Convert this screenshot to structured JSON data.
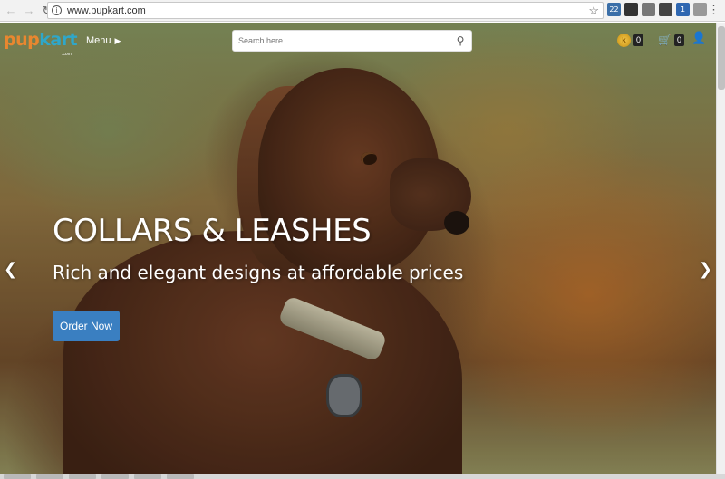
{
  "browser": {
    "url": "www.pupkart.com",
    "back_icon": "back-arrow-icon",
    "forward_icon": "forward-arrow-icon",
    "reload_icon": "reload-icon",
    "extensions": [
      {
        "name": "extension-22",
        "label": "22",
        "color": "#3b6fa8"
      },
      {
        "name": "extension-dark-circle",
        "label": "",
        "color": "#333333"
      },
      {
        "name": "extension-envelope",
        "label": "",
        "color": "#777777"
      },
      {
        "name": "extension-mail",
        "label": "",
        "color": "#444444"
      },
      {
        "name": "extension-badge",
        "label": "1",
        "color": "#2f67b1"
      },
      {
        "name": "extension-pen",
        "label": "",
        "color": "#999999"
      }
    ]
  },
  "site": {
    "logo_pup": "pup",
    "logo_kart": "kart",
    "logo_com": ".com",
    "menu_label": "Menu",
    "search_placeholder": "Search here...",
    "coins_count": "0",
    "cart_count": "0"
  },
  "hero": {
    "title": "COLLARS & LEASHES",
    "subtitle": "Rich and elegant designs at affordable prices",
    "cta_label": "Order Now"
  },
  "colors": {
    "cta": "#3a7fc1",
    "logo_orange": "#e9872f",
    "logo_blue": "#2fa7c9"
  }
}
